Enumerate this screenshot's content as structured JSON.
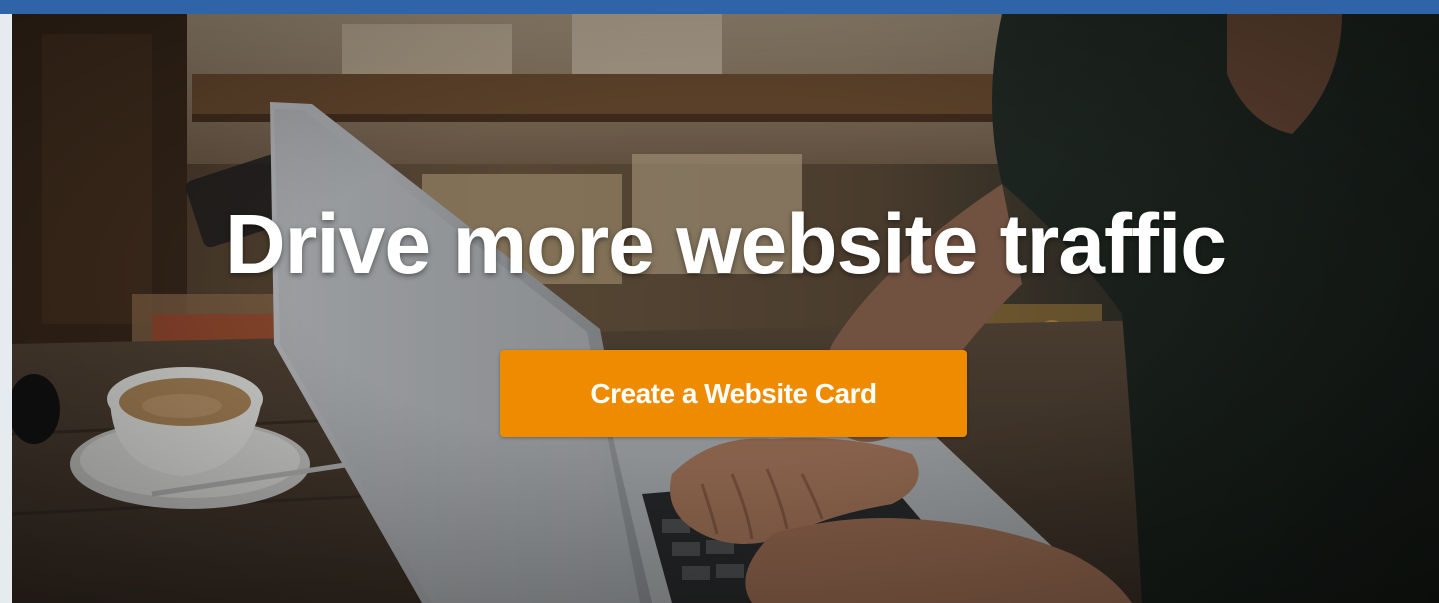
{
  "hero": {
    "headline": "Drive more website traffic",
    "cta_label": "Create a Website Card"
  },
  "colors": {
    "top_bar": "#2f64a8",
    "cta_background": "#ee8b00",
    "headline_text": "#ffffff"
  },
  "background_image": {
    "kind": "photo",
    "icon": "hero-photo"
  }
}
